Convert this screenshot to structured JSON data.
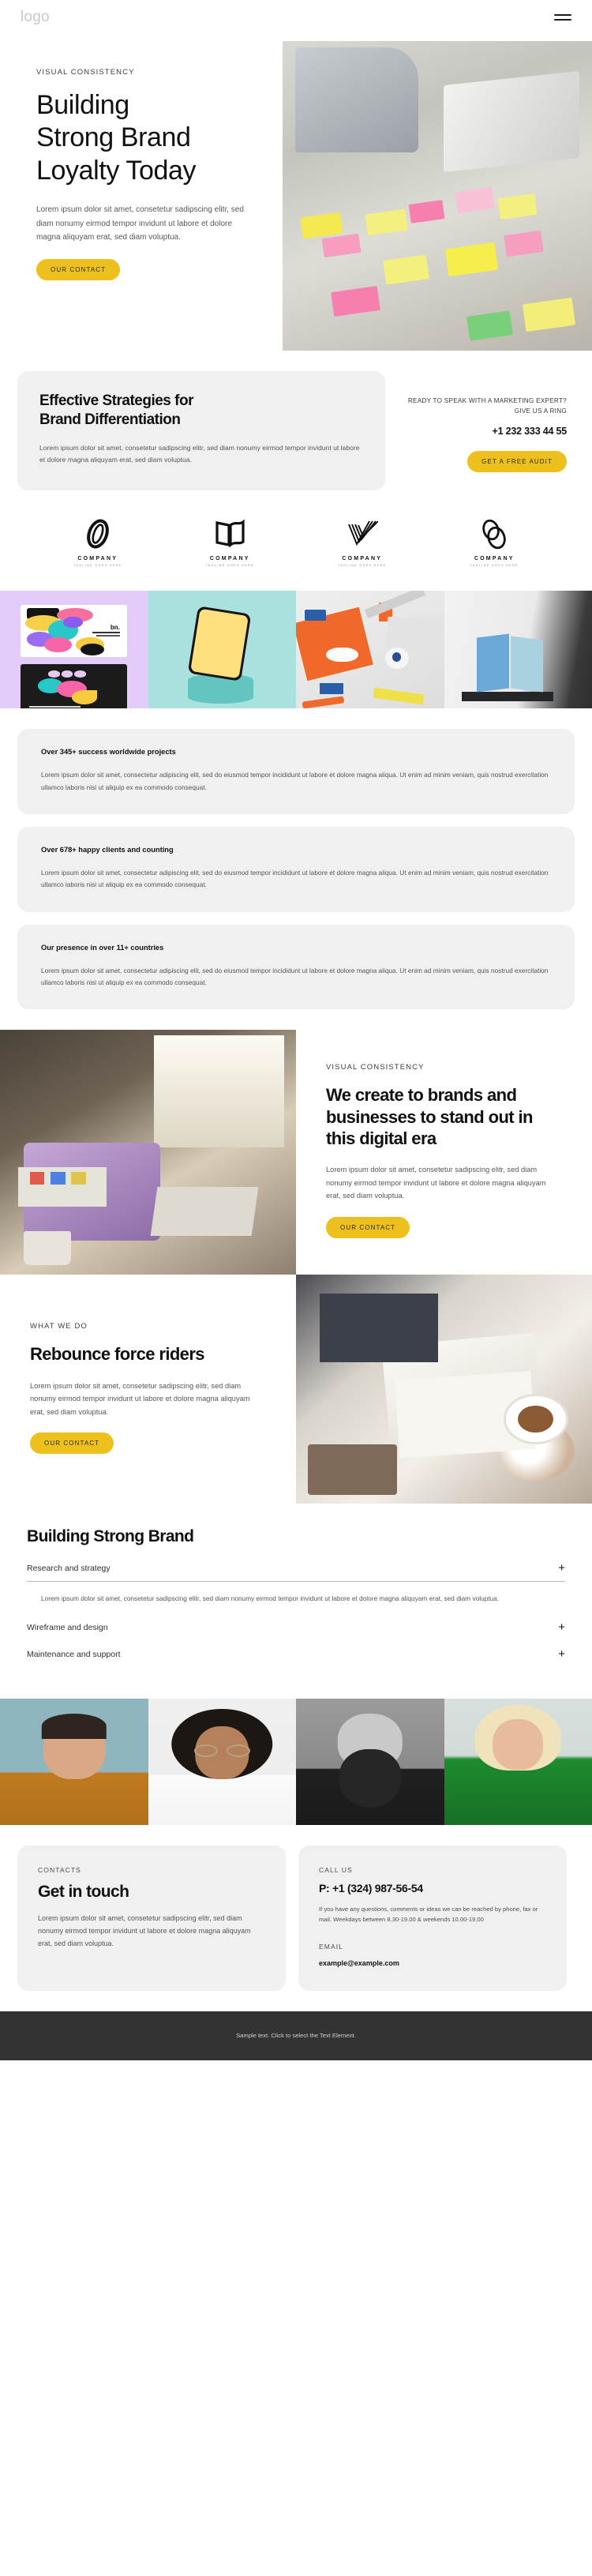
{
  "header": {
    "logo": "logo",
    "menu_icon": "hamburger-icon"
  },
  "hero": {
    "eyebrow": "VISUAL CONSISTENCY",
    "title_lines": [
      "Building",
      "Strong Brand",
      "Loyalty Today"
    ],
    "paragraph": "Lorem ipsum dolor sit amet, consetetur sadipscing elitr, sed diam nonumy eirmod tempor invidunt ut labore et dolore magna aliquyam erat, sed diam voluptua.",
    "button": "OUR CONTACT"
  },
  "strategy": {
    "heading_lines": [
      "Effective Strategies for",
      "Brand Differentiation"
    ],
    "paragraph": "Lorem ipsum dolor sit amet, consetetur sadipscing elitr, sed diam nonumy eirmod tempor invidunt ut labore et dolore magna aliquyam erat, sed diam voluptua.",
    "ready_text": "READY TO SPEAK WITH A MARKETING EXPERT? GIVE US A RING",
    "phone": "+1 232 333 44 55",
    "button": "GET A FREE AUDIT"
  },
  "clients": [
    {
      "name": "COMPANY",
      "tagline": "TAGLINE GOES HERE",
      "mark": "loop-mark-icon"
    },
    {
      "name": "COMPANY",
      "tagline": "TAGLINE GOES HERE",
      "mark": "book-mark-icon"
    },
    {
      "name": "COMPANY",
      "tagline": "TAGLINE GOES HERE",
      "mark": "checkmark-stripes-icon"
    },
    {
      "name": "COMPANY",
      "tagline": "TAGLINE GOES HERE",
      "mark": "double-ellipse-icon"
    }
  ],
  "gallery": [
    {
      "name": "branding-cards-image",
      "label": "bn."
    },
    {
      "name": "phone-mockup-image",
      "label": ""
    },
    {
      "name": "desk-stationery-image",
      "label": ""
    },
    {
      "name": "paper-mockup-image",
      "label": ""
    }
  ],
  "stats": [
    {
      "heading": "Over 345+ success worldwide projects",
      "paragraph": "Lorem ipsum dolor sit amet, consectetur adipiscing elit, sed do eiusmod tempor incididunt ut labore et dolore magna aliqua. Ut enim ad minim veniam, quis nostrud exercitation ullamco laboris nisi ut aliquip ex ea commodo consequat."
    },
    {
      "heading": "Over 678+ happy clients and counting",
      "paragraph": "Lorem ipsum dolor sit amet, consectetur adipiscing elit, sed do eiusmod tempor incididunt ut labore et dolore magna aliqua. Ut enim ad minim veniam, quis nostrud exercitation ullamco laboris nisi ut aliquip ex ea commodo consequat."
    },
    {
      "heading": "Our presence in over 11+ countries",
      "paragraph": "Lorem ipsum dolor sit amet, consectetur adipiscing elit, sed do eiusmod tempor incididunt ut labore et dolore magna aliqua. Ut enim ad minim veniam, quis nostrud exercitation ullamco laboris nisi ut aliquip ex ea commodo consequat."
    }
  ],
  "create": {
    "eyebrow": "VISUAL CONSISTENCY",
    "heading": "We create to brands and businesses to stand out in this digital era",
    "paragraph": "Lorem ipsum dolor sit amet, consetetur sadipscing elitr, sed diam nonumy eirmod tempor invidunt ut labore et dolore magna aliquyam erat, sed diam voluptua.",
    "button": "OUR CONTACT"
  },
  "rebounce": {
    "eyebrow": "WHAT WE DO",
    "heading": "Rebounce force riders",
    "paragraph": "Lorem ipsum dolor sit amet, consetetur sadipscing elitr, sed diam nonumy eirmod tempor invidunt ut labore et dolore magna aliquyam erat, sed diam voluptua.",
    "button": "OUR CONTACT"
  },
  "accordion": {
    "title": "Building Strong Brand",
    "items": [
      {
        "label": "Research and strategy",
        "icon": "plus-icon",
        "open": true,
        "body": "Lorem ipsum dolor sit amet, consetetur sadipscing elitr, sed diam nonumy eirmod tempor invidunt ut labore et dolore magna aliquyam erat, sed diam voluptua."
      },
      {
        "label": "Wireframe and design",
        "icon": "plus-icon",
        "open": false,
        "body": ""
      },
      {
        "label": "Maintenance and support",
        "icon": "plus-icon",
        "open": false,
        "body": ""
      }
    ]
  },
  "team": [
    {
      "name": "team-portrait-1"
    },
    {
      "name": "team-portrait-2"
    },
    {
      "name": "team-portrait-3"
    },
    {
      "name": "team-portrait-4"
    }
  ],
  "contacts": {
    "label": "CONTACTS",
    "heading": "Get in touch",
    "paragraph": "Lorem ipsum dolor sit amet, consetetur sadipscing elitr, sed diam nonumy eirmod tempor invidunt ut labore et dolore magna aliquyam erat, sed diam voluptua.",
    "call_label": "CALL US",
    "phone": "P: +1 (324) 987-56-54",
    "note": "If you have any questions, comments or ideas we can be reached by phone, fax or mail. Weekdays between 8.30-19.00 & weekends 10.00-19.00",
    "email_label": "EMAIL",
    "email": "example@example.com"
  },
  "bottom": {
    "text": "Sample text. Click to select the Text Element."
  },
  "colors": {
    "accent": "#edc01e",
    "card": "#f0f0f0",
    "dark": "#333333",
    "text": "#1b1b1b"
  }
}
